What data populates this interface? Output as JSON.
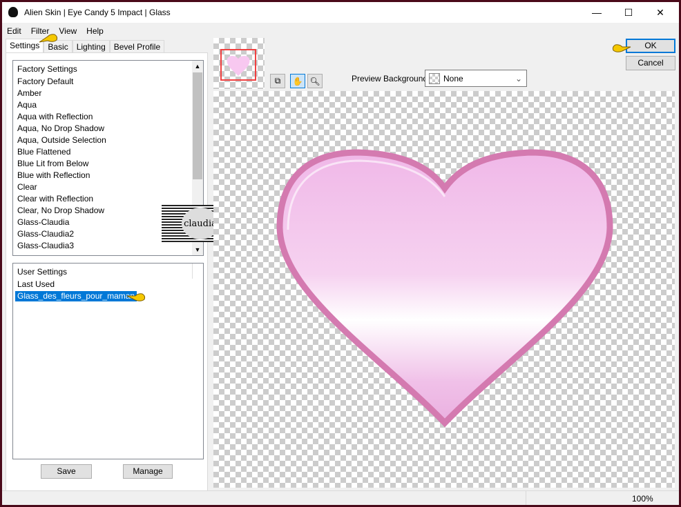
{
  "window": {
    "title": "Alien Skin | Eye Candy 5 Impact | Glass",
    "controls": [
      "—",
      "☐",
      "✕"
    ]
  },
  "menu": [
    "Edit",
    "Filter",
    "View",
    "Help"
  ],
  "tabs": [
    "Settings",
    "Basic",
    "Lighting",
    "Bevel Profile"
  ],
  "factory": {
    "header": "Factory Settings",
    "items": [
      "Factory Default",
      "Amber",
      "Aqua",
      "Aqua with Reflection",
      "Aqua, No Drop Shadow",
      "Aqua, Outside Selection",
      "Blue Flattened",
      "Blue Lit from Below",
      "Blue with Reflection",
      "Clear",
      "Clear with Reflection",
      "Clear, No Drop Shadow",
      "Glass-Claudia",
      "Glass-Claudia2",
      "Glass-Claudia3"
    ]
  },
  "user": {
    "header": "User Settings",
    "items": [
      "Last Used",
      "Glass_des_fleurs_pour_maman"
    ],
    "selected": "Glass_des_fleurs_pour_maman"
  },
  "buttons": {
    "save": "Save",
    "manage": "Manage",
    "ok": "OK",
    "cancel": "Cancel"
  },
  "preview_background": {
    "label": "Preview Background:",
    "value": "None"
  },
  "status": {
    "zoom": "100%"
  },
  "watermark": "claudia",
  "colors": {
    "accent": "#0078d7",
    "heart_rim": "#d47ab0",
    "heart_fill": "#f3c6ea",
    "frame": "#4a0a1a"
  }
}
